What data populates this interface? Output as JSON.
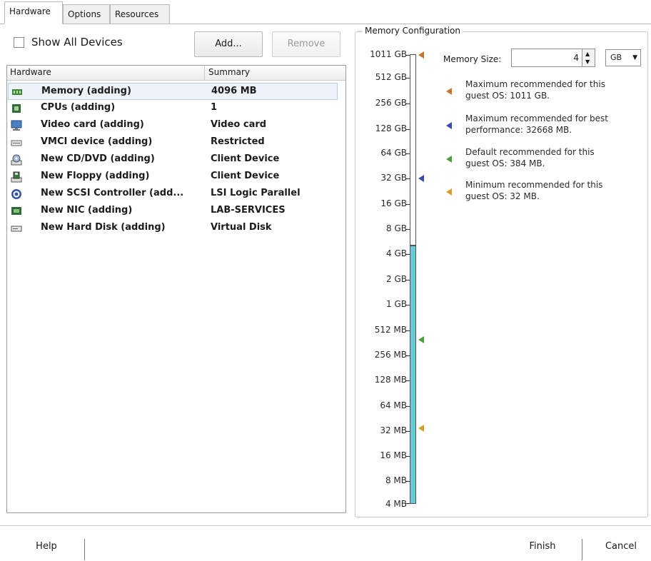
{
  "tabs": [
    "Hardware",
    "Options",
    "Resources"
  ],
  "left": {
    "show_all_label": "Show All Devices",
    "add_label": "Add...",
    "remove_label": "Remove",
    "col_hardware": "Hardware",
    "col_summary": "Summary",
    "rows": [
      {
        "name": "Memory (adding)",
        "summary": "4096 MB",
        "icon": "memory-icon"
      },
      {
        "name": "CPUs (adding)",
        "summary": "1",
        "icon": "cpu-icon"
      },
      {
        "name": "Video card  (adding)",
        "summary": "Video card",
        "icon": "monitor-icon"
      },
      {
        "name": "VMCI device (adding)",
        "summary": "Restricted",
        "icon": "device-icon"
      },
      {
        "name": "New CD/DVD (adding)",
        "summary": "Client Device",
        "icon": "cd-dvd-icon"
      },
      {
        "name": "New Floppy (adding)",
        "summary": "Client Device",
        "icon": "floppy-icon"
      },
      {
        "name": "New SCSI Controller (add...",
        "summary": "LSI Logic Parallel",
        "icon": "scsi-controller-icon"
      },
      {
        "name": "New NIC (adding)",
        "summary": "LAB-SERVICES",
        "icon": "network-card-icon"
      },
      {
        "name": "New Hard Disk (adding)",
        "summary": "Virtual Disk",
        "icon": "hard-disk-icon"
      }
    ]
  },
  "memory": {
    "group_title": "Memory Configuration",
    "size_label": "Memory Size:",
    "size_value": "4",
    "unit_value": "GB",
    "scale": [
      "1011 GB",
      "512 GB",
      "256 GB",
      "128 GB",
      "64 GB",
      "32 GB",
      "16 GB",
      "8 GB",
      "4 GB",
      "2 GB",
      "1 GB",
      "512 MB",
      "256 MB",
      "128 MB",
      "64 MB",
      "32 MB",
      "16 MB",
      "8 MB",
      "4 MB"
    ],
    "legend": [
      {
        "line1": "Maximum recommended for this",
        "line2": "guest OS: 1011 GB.",
        "color": "#c8742a"
      },
      {
        "line1": "Maximum recommended for best",
        "line2": "performance: 32668 MB.",
        "color": "#3a4aa8"
      },
      {
        "line1": "Default recommended for this",
        "line2": "guest OS: 384 MB.",
        "color": "#4aa33a"
      },
      {
        "line1": "Minimum recommended for this",
        "line2": "guest OS: 32 MB.",
        "color": "#d8a02a"
      }
    ]
  },
  "footer": {
    "help_label": "Help",
    "finish_label": "Finish",
    "cancel_label": "Cancel"
  }
}
